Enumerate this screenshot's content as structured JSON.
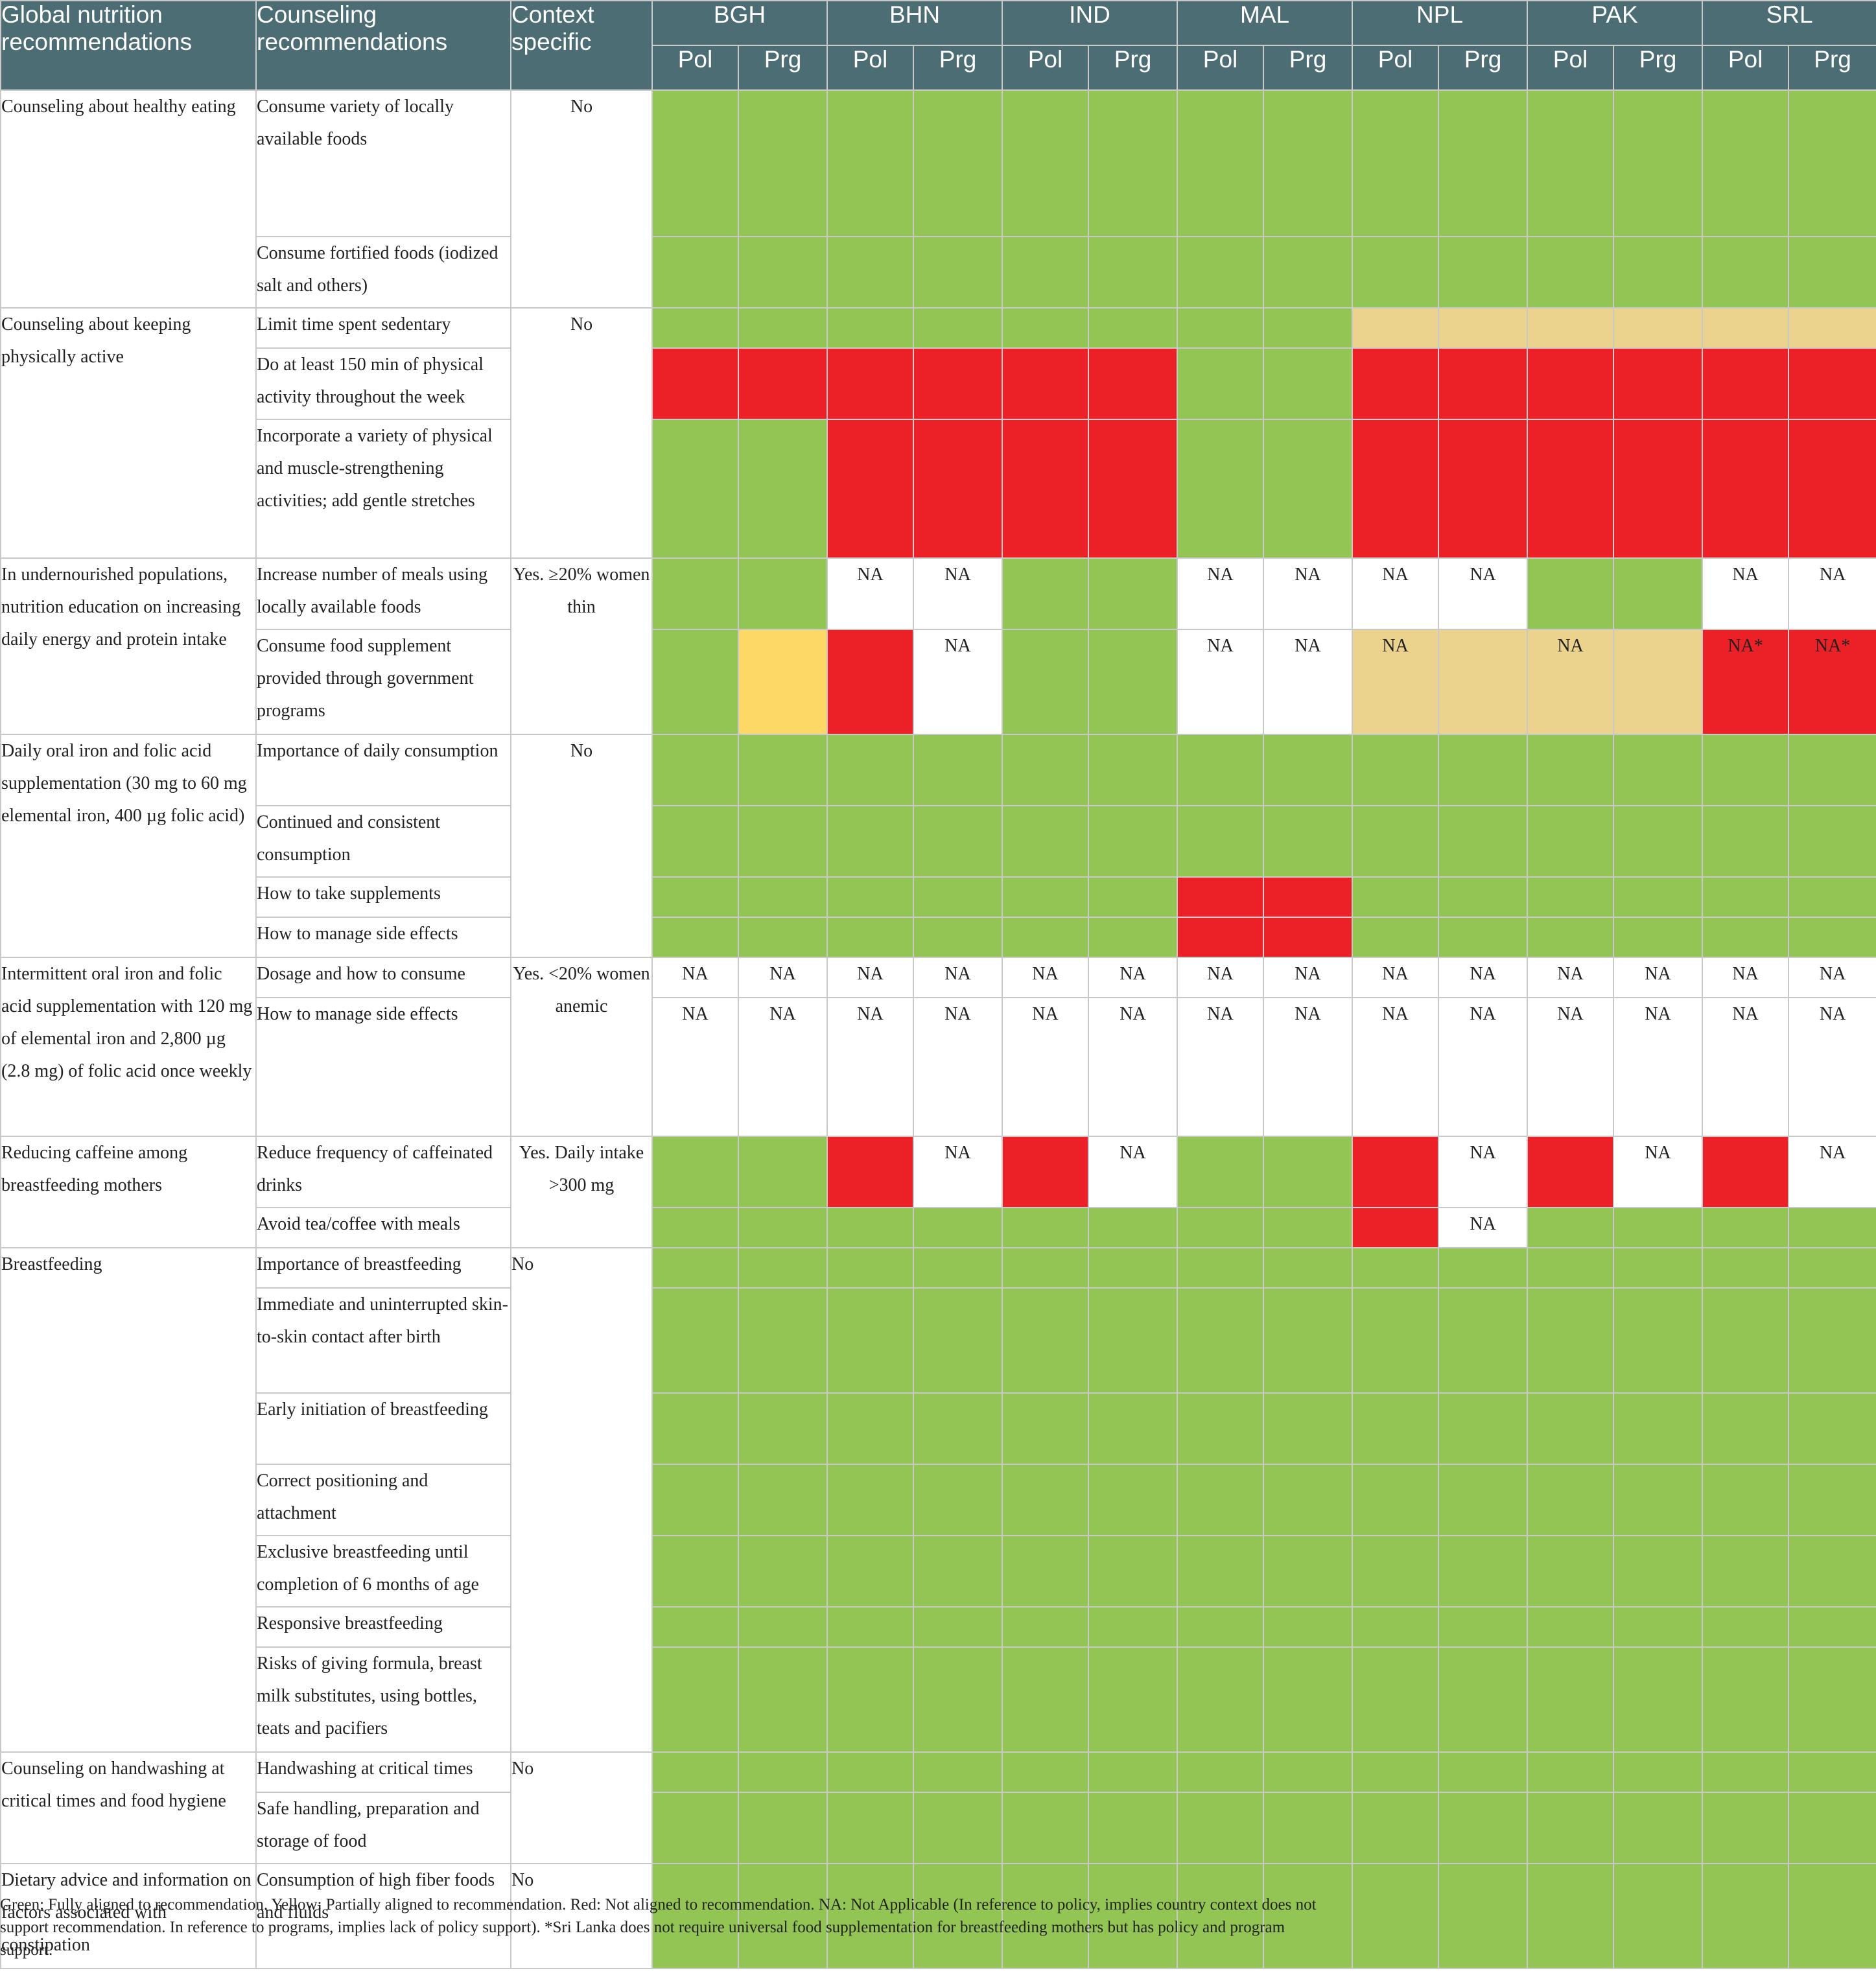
{
  "header": {
    "col1": "Global nutrition recommendations",
    "col2": "Counseling recommendations",
    "col3": "Context specific",
    "countries": [
      "BGH",
      "BHN",
      "IND",
      "MAL",
      "NPL",
      "PAK",
      "SRL"
    ],
    "sub": [
      "Pol",
      "Prg"
    ]
  },
  "colors": {
    "green": "#92c553",
    "red": "#ec2127",
    "yellow": "#fdd866",
    "tan": "#ebd38d",
    "white": "#ffffff",
    "header_bg": "#4d6d75"
  },
  "groups": [
    {
      "global": "Counseling about healthy eating",
      "context": "No",
      "context_align": "middle",
      "rows": [
        {
          "counsel": "Consume variety of locally available foods",
          "cells": [
            "G",
            "G",
            "G",
            "G",
            "G",
            "G",
            "G",
            "G",
            "G",
            "G",
            "G",
            "G",
            "G",
            "G"
          ]
        },
        {
          "counsel": "Consume fortified foods (iodized salt and others)",
          "cells": [
            "G",
            "G",
            "G",
            "G",
            "G",
            "G",
            "G",
            "G",
            "G",
            "G",
            "G",
            "G",
            "G",
            "G"
          ]
        }
      ]
    },
    {
      "global": "Counseling about keeping physically active",
      "context": "No",
      "context_align": "middle",
      "rows": [
        {
          "counsel": "Limit time spent sedentary",
          "cells": [
            "G",
            "G",
            "G",
            "G",
            "G",
            "G",
            "G",
            "G",
            "T",
            "T",
            "T",
            "T",
            "T",
            "T"
          ]
        },
        {
          "counsel": "Do at least 150 min of physical activity throughout the week",
          "cells": [
            "R",
            "R",
            "R",
            "R",
            "R",
            "R",
            "G",
            "G",
            "R",
            "R",
            "R",
            "R",
            "R",
            "R"
          ]
        },
        {
          "counsel": "Incorporate a variety of physical and muscle-strengthening activities; add gentle stretches",
          "cells": [
            "G",
            "G",
            "R",
            "R",
            "R",
            "R",
            "G",
            "G",
            "R",
            "R",
            "R",
            "R",
            "R",
            "R"
          ]
        }
      ]
    },
    {
      "global": "In undernourished populations, nutrition education on increasing daily energy and protein intake",
      "context": "Yes. ≥20% women thin",
      "context_align": "middle",
      "rows": [
        {
          "counsel": "Increase number of meals using locally available foods",
          "cells": [
            "G",
            "G",
            "W:NA",
            "W:NA",
            "G",
            "G",
            "W:NA",
            "W:NA",
            "W:NA",
            "W:NA",
            "G",
            "G",
            "W:NA",
            "W:NA"
          ]
        },
        {
          "counsel": "Consume food supplement provided through government programs",
          "cells": [
            "G",
            "Y",
            "R",
            "W:NA",
            "G",
            "G",
            "W:NA",
            "W:NA",
            "T:NA",
            "T",
            "T:NA",
            "T",
            "R:NA*",
            "R:NA*"
          ]
        }
      ]
    },
    {
      "global": "Daily oral iron and folic acid supplementation (30 mg to 60 mg elemental iron, 400 µg folic acid)",
      "context": "No",
      "context_align": "middle",
      "rows": [
        {
          "counsel": "Importance of daily consumption",
          "cells": [
            "G",
            "G",
            "G",
            "G",
            "G",
            "G",
            "G",
            "G",
            "G",
            "G",
            "G",
            "G",
            "G",
            "G"
          ]
        },
        {
          "counsel": "Continued and consistent consumption",
          "cells": [
            "G",
            "G",
            "G",
            "G",
            "G",
            "G",
            "G",
            "G",
            "G",
            "G",
            "G",
            "G",
            "G",
            "G"
          ]
        },
        {
          "counsel": "How to take supplements",
          "cells": [
            "G",
            "G",
            "G",
            "G",
            "G",
            "G",
            "R",
            "R",
            "G",
            "G",
            "G",
            "G",
            "G",
            "G"
          ]
        },
        {
          "counsel": "How to manage side effects",
          "cells": [
            "G",
            "G",
            "G",
            "G",
            "G",
            "G",
            "R",
            "R",
            "G",
            "G",
            "G",
            "G",
            "G",
            "G"
          ]
        }
      ]
    },
    {
      "global": "Intermittent oral iron and folic acid supplementation with 120 mg of elemental iron and 2,800 µg (2.8 mg) of folic acid once weekly",
      "context": "Yes. <20% women anemic",
      "context_align": "middle",
      "rows": [
        {
          "counsel": "Dosage and how to consume",
          "cells": [
            "W:NA",
            "W:NA",
            "W:NA",
            "W:NA",
            "W:NA",
            "W:NA",
            "W:NA",
            "W:NA",
            "W:NA",
            "W:NA",
            "W:NA",
            "W:NA",
            "W:NA",
            "W:NA"
          ]
        },
        {
          "counsel": "How to manage side effects",
          "cells": [
            "W:NA",
            "W:NA",
            "W:NA",
            "W:NA",
            "W:NA",
            "W:NA",
            "W:NA",
            "W:NA",
            "W:NA",
            "W:NA",
            "W:NA",
            "W:NA",
            "W:NA",
            "W:NA"
          ]
        }
      ]
    },
    {
      "global": "Reducing caffeine among breastfeeding mothers",
      "context": "Yes. Daily intake >300 mg",
      "context_align": "middle",
      "rows": [
        {
          "counsel": "Reduce frequency of caffeinated drinks",
          "cells": [
            "G",
            "G",
            "R",
            "W:NA",
            "R",
            "W:NA",
            "G",
            "G",
            "R",
            "W:NA",
            "R",
            "W:NA",
            "R",
            "W:NA"
          ]
        },
        {
          "counsel": "Avoid tea/coffee with meals",
          "cells": [
            "G",
            "G",
            "G",
            "G",
            "G",
            "G",
            "G",
            "G",
            "R",
            "W:NA",
            "G",
            "G",
            "G",
            "G"
          ]
        }
      ]
    },
    {
      "global": "Breastfeeding",
      "context": "No",
      "context_align": "top",
      "rows": [
        {
          "counsel": "Importance of breastfeeding",
          "cells": [
            "G",
            "G",
            "G",
            "G",
            "G",
            "G",
            "G",
            "G",
            "G",
            "G",
            "G",
            "G",
            "G",
            "G"
          ]
        },
        {
          "counsel": "Immediate and uninterrupted skin-to-skin contact after birth",
          "cells": [
            "G",
            "G",
            "G",
            "G",
            "G",
            "G",
            "G",
            "G",
            "G",
            "G",
            "G",
            "G",
            "G",
            "G"
          ]
        },
        {
          "counsel": "Early initiation of breastfeeding",
          "cells": [
            "G",
            "G",
            "G",
            "G",
            "G",
            "G",
            "G",
            "G",
            "G",
            "G",
            "G",
            "G",
            "G",
            "G"
          ]
        },
        {
          "counsel": "Correct positioning and attachment",
          "cells": [
            "G",
            "G",
            "G",
            "G",
            "G",
            "G",
            "G",
            "G",
            "G",
            "G",
            "G",
            "G",
            "G",
            "G"
          ]
        },
        {
          "counsel": "Exclusive breastfeeding until completion of 6 months of age",
          "cells": [
            "G",
            "G",
            "G",
            "G",
            "G",
            "G",
            "G",
            "G",
            "G",
            "G",
            "G",
            "G",
            "G",
            "G"
          ]
        },
        {
          "counsel": "Responsive breastfeeding",
          "cells": [
            "G",
            "G",
            "G",
            "G",
            "G",
            "G",
            "G",
            "G",
            "G",
            "G",
            "G",
            "G",
            "G",
            "G"
          ]
        },
        {
          "counsel": "Risks of giving formula, breast milk substitutes, using bottles, teats and pacifiers",
          "cells": [
            "G",
            "G",
            "G",
            "G",
            "G",
            "G",
            "G",
            "G",
            "G",
            "G",
            "G",
            "G",
            "G",
            "G"
          ]
        }
      ]
    },
    {
      "global": "Counseling on handwashing at critical times and food hygiene",
      "context": "No",
      "context_align": "top",
      "rows": [
        {
          "counsel": "Handwashing at critical times",
          "cells": [
            "G",
            "G",
            "G",
            "G",
            "G",
            "G",
            "G",
            "G",
            "G",
            "G",
            "G",
            "G",
            "G",
            "G"
          ]
        },
        {
          "counsel": "Safe handling, preparation and storage of food",
          "cells": [
            "G",
            "G",
            "G",
            "G",
            "G",
            "G",
            "G",
            "G",
            "G",
            "G",
            "G",
            "G",
            "G",
            "G"
          ]
        }
      ]
    },
    {
      "global": "Dietary advice and information on factors associated with constipation",
      "context": "No",
      "context_align": "top",
      "rows": [
        {
          "counsel": "Consumption of high fiber foods and fluids",
          "cells": [
            "G",
            "G",
            "G",
            "G",
            "G",
            "G",
            "G",
            "G",
            "G",
            "G",
            "G",
            "G",
            "G",
            "G"
          ]
        }
      ]
    }
  ],
  "footnote": "Green: Fully aligned to recommendation. Yellow: Partially aligned to recommendation. Red: Not aligned to recommendation. NA: Not Applicable (In reference to policy, implies country context does not support recommendation. In reference to programs, implies lack of policy support). *Sri Lanka does not require universal food supplementation for breastfeeding mothers but has policy and program support."
}
